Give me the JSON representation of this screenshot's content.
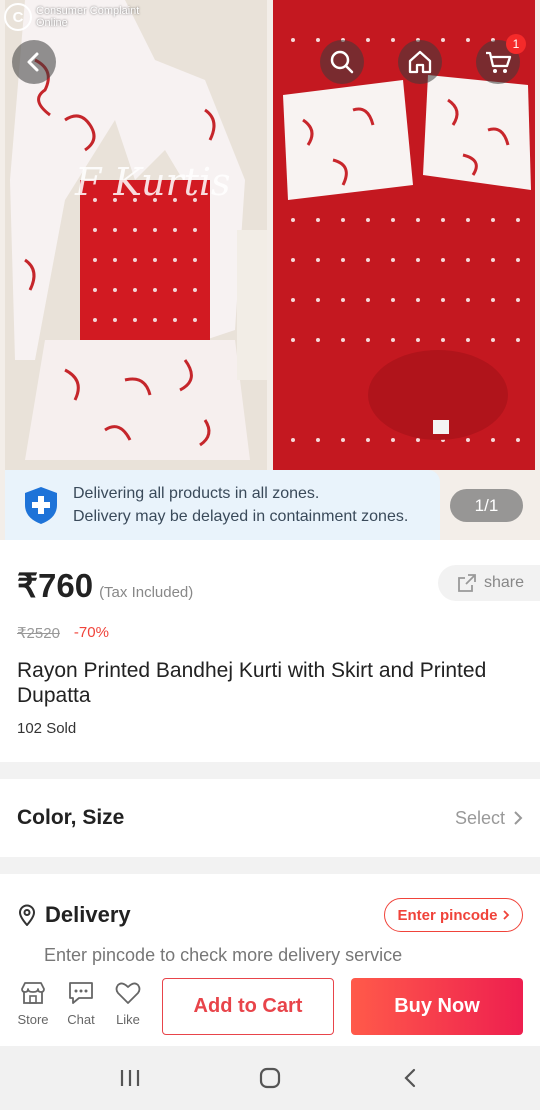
{
  "status_overlay": {
    "line1": "Consumer Complaint",
    "line2": "Online"
  },
  "gallery": {
    "watermark": "F Kurtis",
    "pager": "1/1",
    "cart_count": "1",
    "notice_line1": "Delivering all products in all zones.",
    "notice_line2": "Delivery may be delayed in containment zones."
  },
  "product": {
    "price": "₹760",
    "tax_note": "(Tax Included)",
    "original_price": "₹2520",
    "discount": "-70%",
    "title": "Rayon Printed Bandhej Kurti with Skirt and Printed Dupatta",
    "sold": "102 Sold",
    "share_label": "share"
  },
  "variant": {
    "label": "Color, Size",
    "select_label": "Select"
  },
  "delivery": {
    "title": "Delivery",
    "pincode_button": "Enter pincode",
    "hint": "Enter pincode to check more delivery service"
  },
  "actions": {
    "store_label": "Store",
    "chat_label": "Chat",
    "like_label": "Like",
    "add_to_cart": "Add to Cart",
    "buy_now": "Buy Now"
  },
  "colors": {
    "accent": "#f0433a",
    "buy_gradient_start": "#ff5a4a",
    "buy_gradient_end": "#ee1f4f",
    "fabric_red": "#c8161d"
  },
  "icons": [
    "back-icon",
    "search-icon",
    "home-icon",
    "cart-icon",
    "shield-plus-icon",
    "share-icon",
    "chevron-right-icon",
    "location-pin-icon",
    "store-icon",
    "chat-icon",
    "heart-icon",
    "recent-apps-icon",
    "home-nav-icon",
    "back-nav-icon"
  ]
}
